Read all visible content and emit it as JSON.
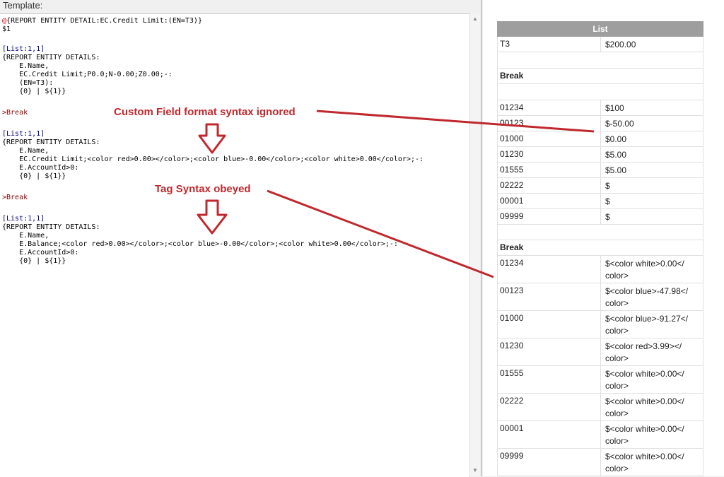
{
  "template_label": "Template:",
  "code": {
    "block1_l1": "{REPORT ENTITY DETAIL:EC.Credit Limit:(EN=T3)}",
    "block1_l2": "$1",
    "list1_head": "[List:1,1]",
    "list1_l1": "{REPORT ENTITY DETAILS:",
    "list1_l2": "    E.Name,",
    "list1_l3": "    EC.Credit Limit;P0.0;N-0.00;Z0.00;-:",
    "list1_l4": "    (EN=T3):",
    "list1_l5": "    {0} | ${1}}",
    "break1": ">Break",
    "list2_head": "[List:1,1]",
    "list2_l1": "{REPORT ENTITY DETAILS:",
    "list2_l2": "    E.Name,",
    "list2_l3": "    EC.Credit Limit;<color red>0.00></color>;<color blue>-0.00</color>;<color white>0.00</color>;-:",
    "list2_l4": "    E.AccountId>0:",
    "list2_l5": "    {0} | ${1}}",
    "break2": ">Break",
    "list3_head": "[List:1,1]",
    "list3_l1": "{REPORT ENTITY DETAILS:",
    "list3_l2": "    E.Name,",
    "list3_l3": "    E.Balance;<color red>0.00></color>;<color blue>-0.00</color>;<color white>0.00</color>;-:",
    "list3_l4": "    E.AccountId>0:",
    "list3_l5": "    {0} | ${1}}"
  },
  "annotations": {
    "ignored": "Custom Field format syntax ignored",
    "obeyed": "Tag Syntax obeyed",
    "arrow_color": "#c0282d"
  },
  "table": {
    "header": "List",
    "row0": {
      "name": "T3",
      "value": "$200.00"
    },
    "break_label": "Break",
    "section1": [
      {
        "name": "01234",
        "value": "$100"
      },
      {
        "name": "00123",
        "value": "$-50.00"
      },
      {
        "name": "01000",
        "value": "$0.00"
      },
      {
        "name": "01230",
        "value": "$5.00"
      },
      {
        "name": "01555",
        "value": "$5.00"
      },
      {
        "name": "02222",
        "value": "$"
      },
      {
        "name": "00001",
        "value": "$"
      },
      {
        "name": "09999",
        "value": "$"
      }
    ],
    "section2": [
      {
        "name": "01234",
        "value": "$<color white>0.00</ color>"
      },
      {
        "name": "00123",
        "value": "$<color blue>-47.98</ color>"
      },
      {
        "name": "01000",
        "value": "$<color blue>-91.27</ color>"
      },
      {
        "name": "01230",
        "value": "$<color red>3.99></ color>"
      },
      {
        "name": "01555",
        "value": "$<color white>0.00</ color>"
      },
      {
        "name": "02222",
        "value": "$<color white>0.00</ color>"
      },
      {
        "name": "00001",
        "value": "$<color white>0.00</ color>"
      },
      {
        "name": "09999",
        "value": "$<color white>0.00</ color>"
      }
    ]
  }
}
